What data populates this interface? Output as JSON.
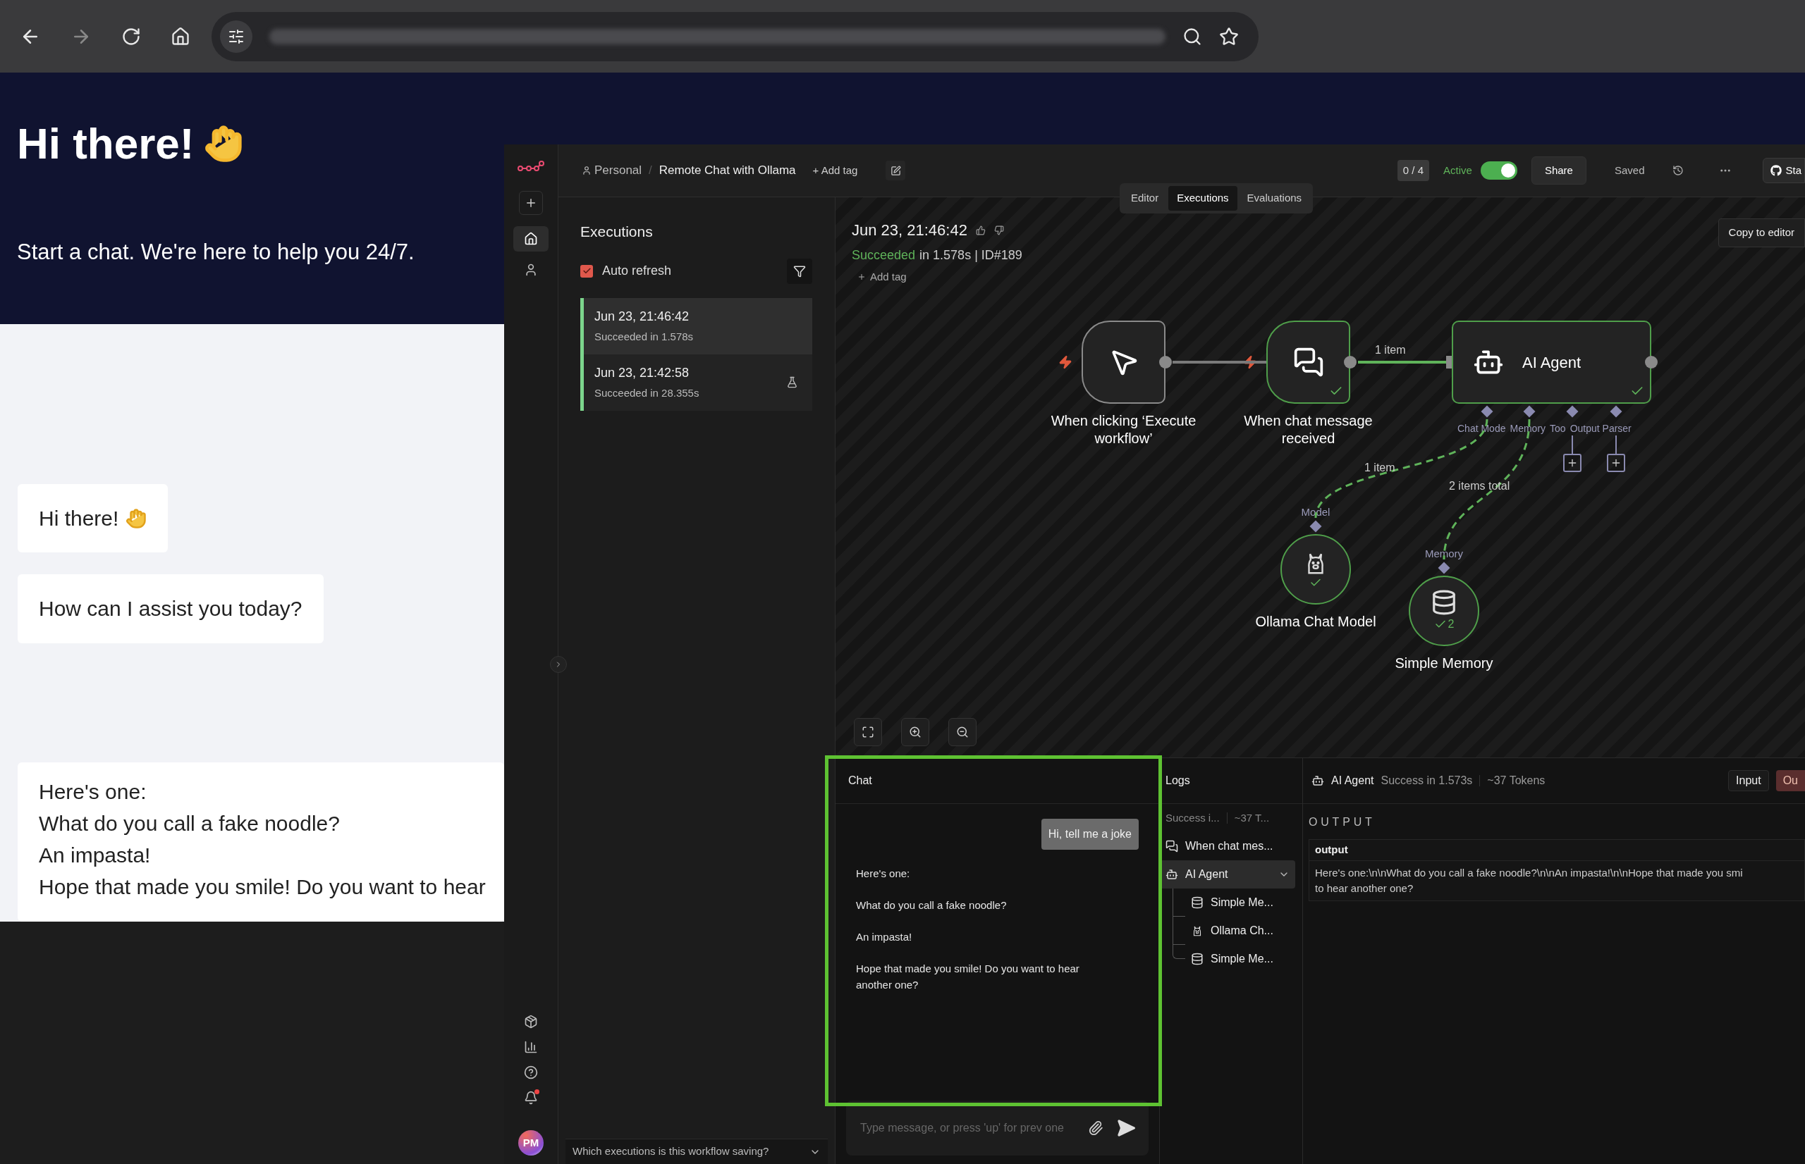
{
  "chat_widget": {
    "title": "Hi there!",
    "subtitle": "Start a chat. We're here to help you 24/7.",
    "messages": [
      {
        "lines": [
          "Hi there!"
        ],
        "wave": true
      },
      {
        "lines": [
          "How can I assist you today?"
        ],
        "wave": false
      },
      {
        "lines": [
          "Here's one:",
          "What do you call a fake noodle?",
          "An impasta!",
          "Hope that made you smile! Do you want to hear"
        ],
        "wave": false
      }
    ]
  },
  "sidebar": {
    "nav": [
      {
        "kind": "home",
        "selected": true
      },
      {
        "kind": "user",
        "selected": false
      }
    ],
    "notifications": true,
    "avatar": "PM"
  },
  "header": {
    "breadcrumb": [
      "Personal",
      "Remote Chat with Ollama"
    ],
    "separator": "/",
    "add_tag": "+ Add tag",
    "counter": "0 / 4",
    "active_label": "Active",
    "active": true,
    "share": "Share",
    "saved": "Saved",
    "github": "Sta"
  },
  "view_tabs": [
    {
      "label": "Editor",
      "selected": false
    },
    {
      "label": "Executions",
      "selected": true
    },
    {
      "label": "Evaluations",
      "selected": false
    }
  ],
  "executions_panel": {
    "title": "Executions",
    "auto_refresh": {
      "label": "Auto refresh",
      "checked": true
    },
    "items": [
      {
        "time": "Jun 23, 21:46:42",
        "status": "Succeeded in 1.578s",
        "selected": true,
        "test": false
      },
      {
        "time": "Jun 23, 21:42:58",
        "status": "Succeeded in 28.355s",
        "selected": false,
        "test": true
      }
    ],
    "footer": "Which executions is this workflow saving?"
  },
  "execution": {
    "time": "Jun 23, 21:46:42",
    "status": "Succeeded",
    "detail": "in 1.578s | ID#189",
    "add_tag": "Add tag",
    "copy_button": "Copy to editor"
  },
  "canvas": {
    "nodes": [
      {
        "kind": "trigger",
        "label": "When clicking ‘Execute workflow’",
        "success": false
      },
      {
        "kind": "trigger",
        "label": "When chat message received",
        "success": true
      },
      {
        "kind": "agent",
        "label": "AI Agent",
        "success": true,
        "ports": [
          "Chat Mode",
          "Memory",
          "Too",
          "Output Parser"
        ]
      },
      {
        "kind": "sub",
        "label": "Ollama Chat Model",
        "success": true,
        "port": "Model"
      },
      {
        "kind": "sub",
        "label": "Simple Memory",
        "success": true,
        "count": "2",
        "port": "Memory"
      }
    ],
    "edges": [
      {
        "kind": "main",
        "success": false
      },
      {
        "kind": "main",
        "success": true,
        "label": "1 item"
      },
      {
        "kind": "sub",
        "success": true,
        "label": "1 item"
      },
      {
        "kind": "sub",
        "success": true,
        "label": "2 items total"
      }
    ]
  },
  "chat": {
    "title": "Chat",
    "messages": [
      {
        "kind": "sent",
        "paragraphs": [
          "Hi, tell me a joke"
        ]
      },
      {
        "kind": "received",
        "paragraphs": [
          "Here's one:",
          "What do you call a fake noodle?",
          "An impasta!",
          "Hope that made you smile! Do you want to hear another one?"
        ]
      }
    ],
    "placeholder": "Type message, or press 'up' for prev one"
  },
  "logs": {
    "title": "Logs",
    "summary": [
      "Success i...",
      "~37 T..."
    ],
    "tree": [
      {
        "label": "When chat mes...",
        "selected": false
      },
      {
        "label": "AI Agent",
        "selected": true,
        "expanded": true,
        "children": [
          {
            "label": "Simple Me..."
          },
          {
            "label": "Ollama Ch..."
          },
          {
            "label": "Simple Me..."
          }
        ]
      }
    ]
  },
  "output": {
    "node": "AI Agent",
    "status": "Success in 1.573s",
    "tokens": "~37 Tokens",
    "tabs": [
      {
        "label": "Input",
        "selected": false
      },
      {
        "label": "Ou",
        "selected": true
      }
    ],
    "heading": "OUTPUT",
    "field": "output",
    "value": [
      "Here's one:\\n\\nWhat do you call a fake noodle?\\n\\nAn impasta!\\n\\nHope that made you smi",
      "to hear another one?"
    ]
  }
}
